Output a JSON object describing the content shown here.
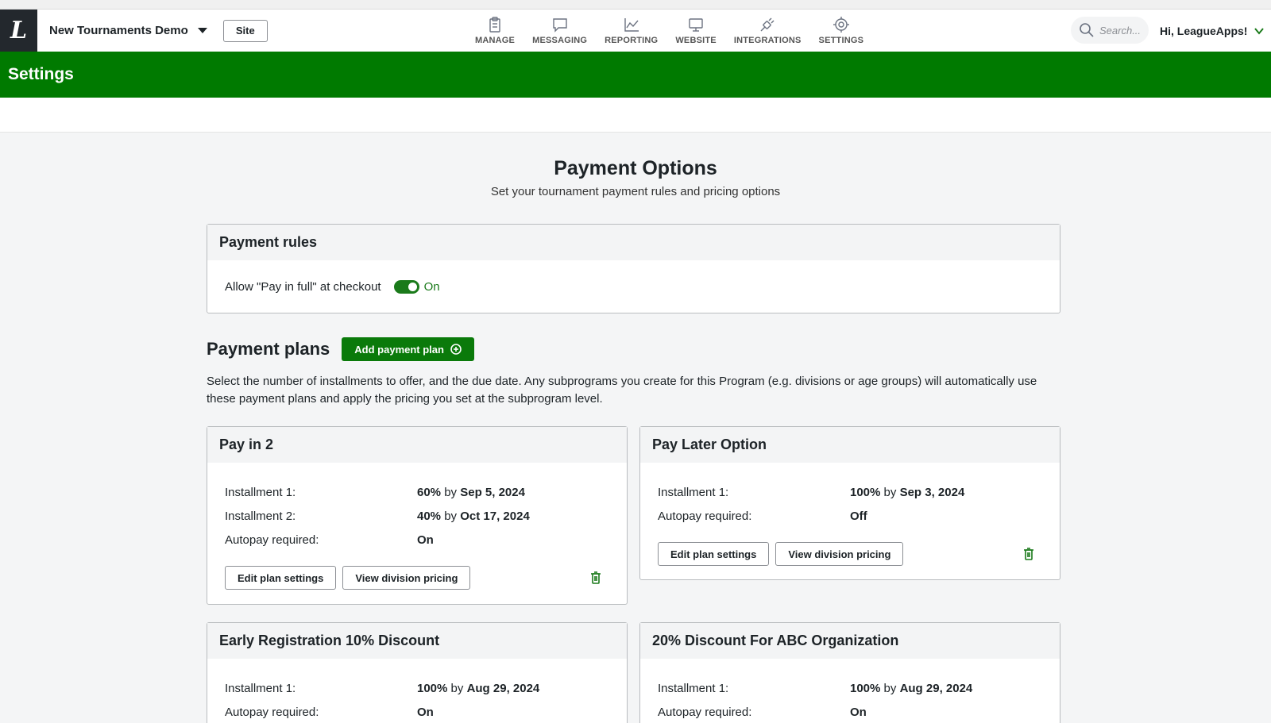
{
  "header": {
    "org_name": "New Tournaments Demo",
    "site_label": "Site",
    "nav": [
      {
        "label": "MANAGE",
        "icon": "clipboard-icon"
      },
      {
        "label": "MESSAGING",
        "icon": "chat-bubble-icon"
      },
      {
        "label": "REPORTING",
        "icon": "line-chart-icon"
      },
      {
        "label": "WEBSITE",
        "icon": "monitor-icon"
      },
      {
        "label": "INTEGRATIONS",
        "icon": "plug-icon"
      },
      {
        "label": "SETTINGS",
        "icon": "gear-icon"
      }
    ],
    "search_placeholder": "Search...",
    "greeting": "Hi, LeagueApps!"
  },
  "page": {
    "band_title": "Settings",
    "title": "Payment Options",
    "subtitle": "Set your tournament payment rules and pricing options"
  },
  "payment_rules": {
    "title": "Payment rules",
    "pay_in_full_label": "Allow \"Pay in full\" at checkout",
    "pay_in_full_state": "On"
  },
  "payment_plans": {
    "title": "Payment plans",
    "add_label": "Add payment plan",
    "description": "Select the number of installments to offer, and the due date. Any subprograms you create for this Program (e.g. divisions or age groups) will automatically use these payment plans and apply the pricing you set at the subprogram level.",
    "edit_label": "Edit plan settings",
    "view_label": "View division pricing",
    "by_word": "by",
    "plans": [
      {
        "name": "Pay in 2",
        "installments": [
          {
            "label": "Installment 1:",
            "percent": "60%",
            "date": "Sep 5, 2024"
          },
          {
            "label": "Installment 2:",
            "percent": "40%",
            "date": "Oct 17, 2024"
          }
        ],
        "autopay_label": "Autopay required:",
        "autopay": "On"
      },
      {
        "name": "Pay Later Option",
        "installments": [
          {
            "label": "Installment 1:",
            "percent": "100%",
            "date": "Sep 3, 2024"
          }
        ],
        "autopay_label": "Autopay required:",
        "autopay": "Off"
      },
      {
        "name": "Early Registration 10% Discount",
        "installments": [
          {
            "label": "Installment 1:",
            "percent": "100%",
            "date": "Aug 29, 2024"
          }
        ],
        "autopay_label": "Autopay required:",
        "autopay": "On"
      },
      {
        "name": "20% Discount For ABC Organization",
        "installments": [
          {
            "label": "Installment 1:",
            "percent": "100%",
            "date": "Aug 29, 2024"
          }
        ],
        "autopay_label": "Autopay required:",
        "autopay": "On"
      }
    ]
  }
}
